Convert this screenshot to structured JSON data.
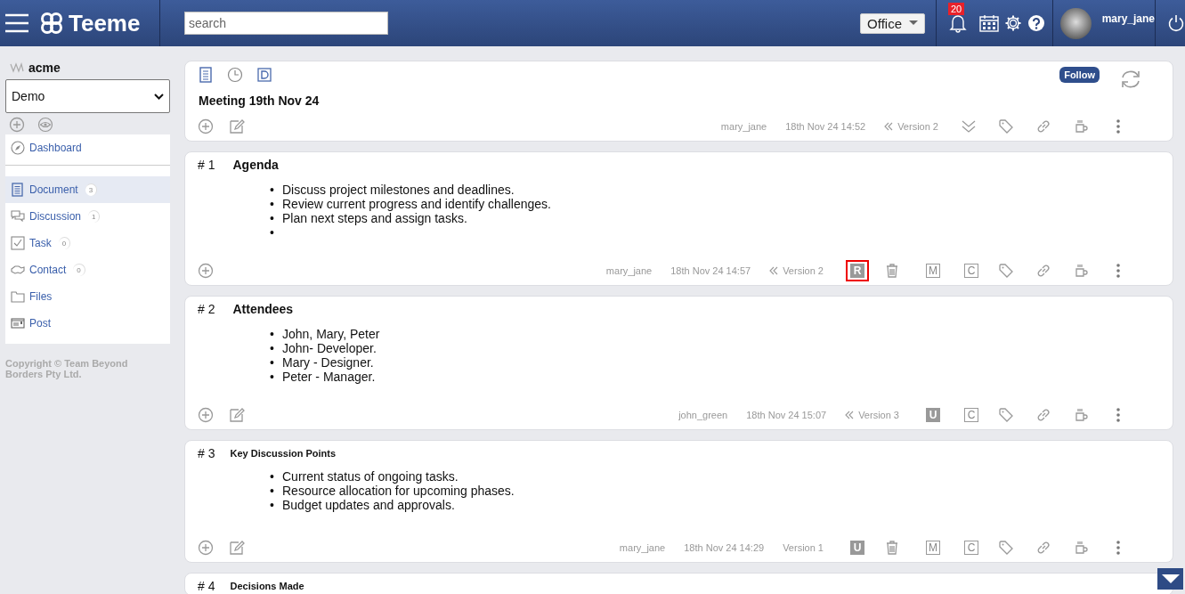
{
  "header": {
    "app_name": "Teeme",
    "search": {
      "placeholder": "search"
    },
    "workplace": "Office",
    "notifications": "20",
    "user": "mary_jane"
  },
  "sidebar": {
    "org": "acme",
    "space_select": "Demo",
    "items": [
      {
        "kind": "dashboard",
        "label": "Dashboard",
        "selected": false
      },
      {
        "kind": "document",
        "label": "Document",
        "count": "3",
        "selected": true
      },
      {
        "kind": "discussion",
        "label": "Discussion",
        "count": "1",
        "selected": false
      },
      {
        "kind": "task",
        "label": "Task",
        "count": "0",
        "selected": false
      },
      {
        "kind": "contact",
        "label": "Contact",
        "count": "0",
        "selected": false
      },
      {
        "kind": "files",
        "label": "Files",
        "selected": false
      },
      {
        "kind": "post",
        "label": "Post",
        "selected": false
      }
    ],
    "copyright": "Copyright © Team Beyond Borders Pty Ltd."
  },
  "document": {
    "title": "Meeting 19th Nov 24",
    "follow": "Follow",
    "user": "mary_jane",
    "date": "18th Nov 24 14:52",
    "version": {
      "label": "Version 2",
      "history": true
    },
    "tools": [
      {
        "kind": "collapse"
      },
      {
        "kind": "tag"
      },
      {
        "kind": "link"
      },
      {
        "kind": "cup"
      },
      {
        "kind": "more"
      }
    ]
  },
  "sections": [
    {
      "number": "# 1",
      "title": "Agenda",
      "title_small": false,
      "marker": "•",
      "items": [
        "Discuss project milestones and deadlines.",
        "Review current progress and identify challenges.",
        "Plan next steps and assign tasks."
      ],
      "trailing_empty_item": true,
      "editable": false,
      "user": "mary_jane",
      "date": "18th Nov 24 14:57",
      "version": {
        "label": "Version 2",
        "history": true
      },
      "tools": [
        {
          "kind": "letter",
          "text": "R",
          "filled": true,
          "highlighted": true
        },
        {
          "kind": "trash"
        },
        {
          "kind": "letter",
          "text": "M",
          "filled": false,
          "highlighted": false
        },
        {
          "kind": "letter",
          "text": "C",
          "filled": false,
          "highlighted": false
        },
        {
          "kind": "tag"
        },
        {
          "kind": "link"
        },
        {
          "kind": "cup"
        },
        {
          "kind": "more"
        }
      ]
    },
    {
      "number": "# 2",
      "title": "Attendees",
      "title_small": false,
      "marker": "•",
      "items": [
        "John, Mary, Peter",
        "John- Developer.",
        "Mary - Designer.",
        "Peter - Manager."
      ],
      "trailing_empty_item": false,
      "editable": true,
      "user": "john_green",
      "date": "18th Nov 24 15:07",
      "version": {
        "label": "Version 3",
        "history": true
      },
      "tools": [
        {
          "kind": "letter",
          "text": "U",
          "filled": true,
          "highlighted": false
        },
        {
          "kind": "letter",
          "text": "C",
          "filled": false,
          "highlighted": false
        },
        {
          "kind": "tag"
        },
        {
          "kind": "link"
        },
        {
          "kind": "cup"
        },
        {
          "kind": "more"
        }
      ]
    },
    {
      "number": "# 3",
      "title": "Key Discussion Points",
      "title_small": true,
      "marker": "•",
      "items": [
        "Current status of ongoing tasks.",
        "Resource allocation for upcoming phases.",
        "Budget updates and approvals."
      ],
      "trailing_empty_item": false,
      "editable": true,
      "user": "mary_jane",
      "date": "18th Nov 24 14:29",
      "version": {
        "label": "Version 1",
        "history": false
      },
      "tools": [
        {
          "kind": "letter",
          "text": "U",
          "filled": true,
          "highlighted": false
        },
        {
          "kind": "trash"
        },
        {
          "kind": "letter",
          "text": "M",
          "filled": false,
          "highlighted": false
        },
        {
          "kind": "letter",
          "text": "C",
          "filled": false,
          "highlighted": false
        },
        {
          "kind": "tag"
        },
        {
          "kind": "link"
        },
        {
          "kind": "cup"
        },
        {
          "kind": "more"
        }
      ]
    },
    {
      "number": "# 4",
      "title": "Decisions Made",
      "title_small": true
    }
  ]
}
